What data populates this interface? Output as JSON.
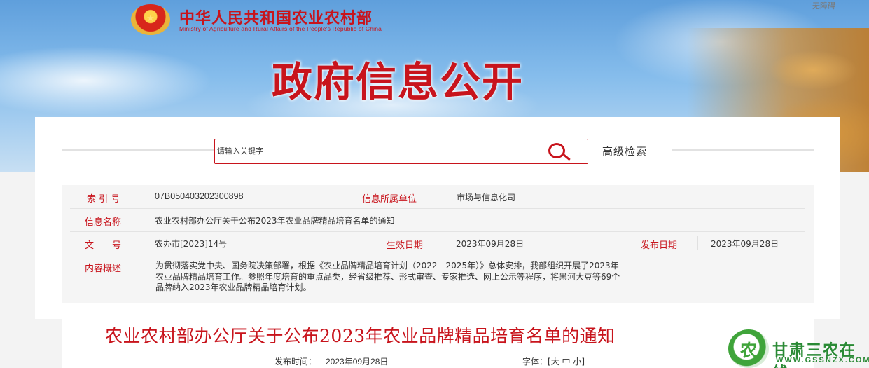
{
  "header": {
    "emblem_glyph": "★",
    "site_title": "中华人民共和国农业农村部",
    "site_subtitle": "Ministry of Agriculture and Rural Affairs of the People's Republic of China",
    "accessibility_link": "无障碍",
    "page_title": "政府信息公开"
  },
  "search": {
    "placeholder": "请输入关键字",
    "advanced_label": "高级检索"
  },
  "meta": {
    "index_label": "索 引 号",
    "index_value": "07B050403202300898",
    "unit_label": "信息所属单位",
    "unit_value": "市场与信息化司",
    "name_label": "信息名称",
    "name_value": "农业农村部办公厅关于公布2023年农业品牌精品培育名单的通知",
    "doc_label": "文　　号",
    "doc_value": "农办市[2023]14号",
    "effective_label": "生效日期",
    "effective_value": "2023年09月28日",
    "publish_label": "发布日期",
    "publish_value": "2023年09月28日",
    "summary_label": "内容概述",
    "summary_lines": [
      "为贯彻落实党中央、国务院决策部署，根据《农业品牌精品培育计划（2022—2025年）》总体安排，我部组织开展了2023年",
      "农业品牌精品培育工作。参照年度培育的重点品类，经省级推荐、形式审查、专家推选、网上公示等程序，将黑河大豆等69个",
      "品牌纳入2023年农业品牌精品培育计划。"
    ]
  },
  "article": {
    "title": "农业农村部办公厅关于公布2023年农业品牌精品培育名单的通知",
    "publish_time_label": "发布时间：",
    "publish_time_value": "2023年09月28日",
    "font_size_label": "字体：",
    "font_size_open": "[",
    "font_large": "大",
    "font_medium": "中",
    "font_small": "小",
    "font_size_close": "]"
  },
  "watermark": {
    "logo_glyph": "农",
    "name": "甘肃三农在线",
    "url": "WWW.GSSNZX.COM"
  },
  "colors": {
    "accent": "#c8141c",
    "watermark_green": "#2a8a35"
  }
}
